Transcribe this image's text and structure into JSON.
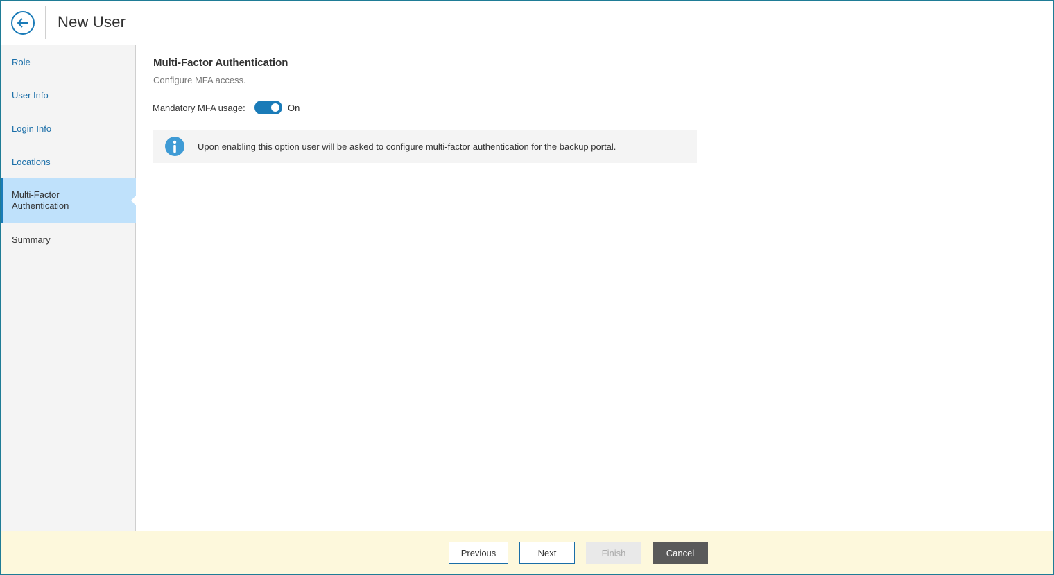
{
  "header": {
    "title": "New User"
  },
  "sidebar": {
    "steps": [
      {
        "label": "Role",
        "state": "link"
      },
      {
        "label": "User Info",
        "state": "link"
      },
      {
        "label": "Login Info",
        "state": "link"
      },
      {
        "label": "Locations",
        "state": "link"
      },
      {
        "label": "Multi-Factor Authentication",
        "state": "active"
      },
      {
        "label": "Summary",
        "state": "pending"
      }
    ]
  },
  "main": {
    "section_title": "Multi-Factor Authentication",
    "section_description": "Configure MFA access.",
    "mfa_toggle": {
      "label": "Mandatory MFA usage:",
      "state_label": "On",
      "on": true
    },
    "info": {
      "icon": "info-icon",
      "text": "Upon enabling this option user will be asked to configure multi-factor authentication for the backup portal."
    }
  },
  "footer": {
    "previous_label": "Previous",
    "next_label": "Next",
    "finish_label": "Finish",
    "cancel_label": "Cancel"
  },
  "colors": {
    "accent": "#1a7bb8",
    "active_step_bg": "#bfe1fb",
    "footer_bg": "#fdf8dc",
    "cancel_bg": "#5a5a5a"
  }
}
